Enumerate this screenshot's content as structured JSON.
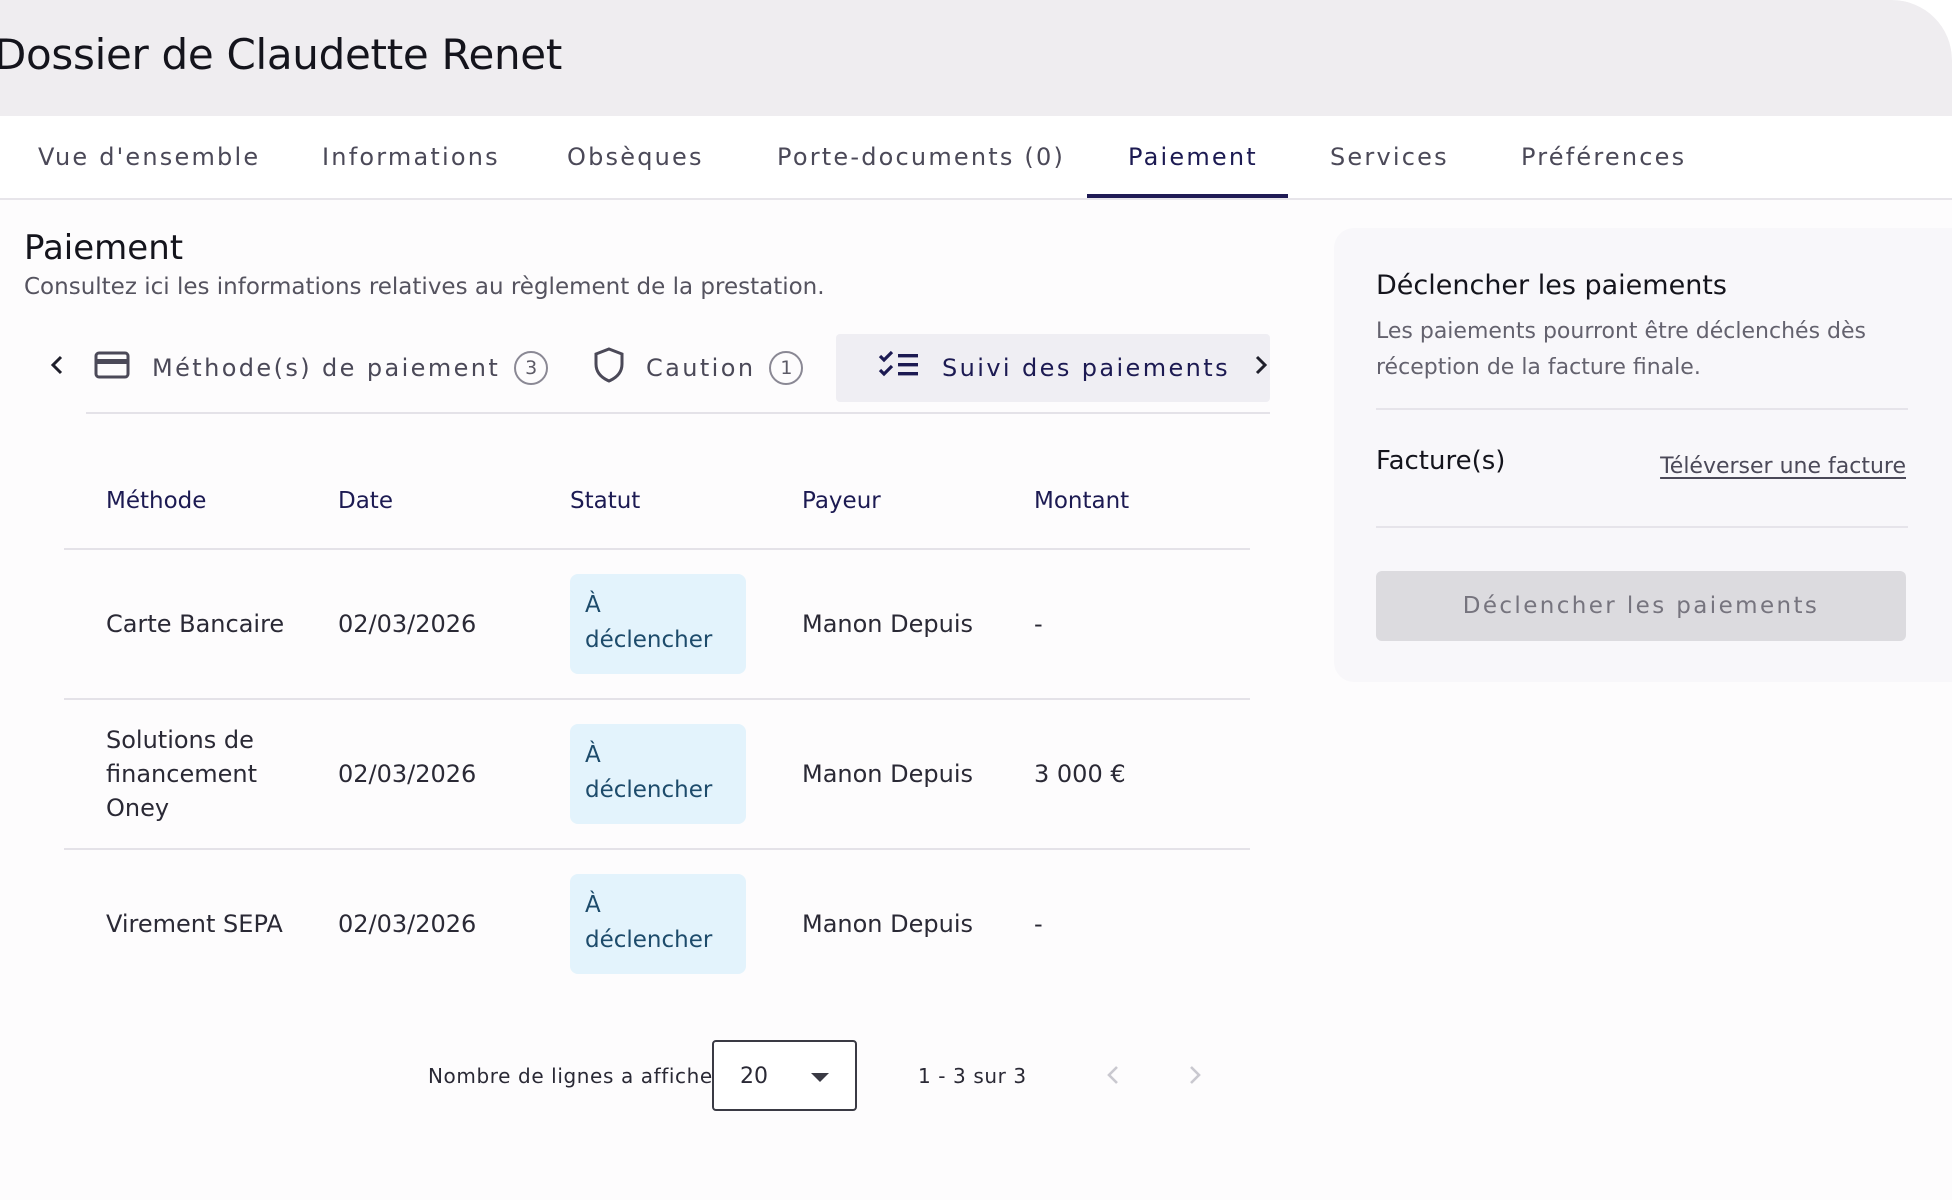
{
  "header": {
    "title": "Dossier de Claudette Renet"
  },
  "tabs": [
    {
      "label": "Vue d'ensemble"
    },
    {
      "label": "Informations"
    },
    {
      "label": "Obsèques"
    },
    {
      "label": "Porte-documents (0)"
    },
    {
      "label": "Paiement",
      "active": true
    },
    {
      "label": "Services"
    },
    {
      "label": "Préférences"
    }
  ],
  "section": {
    "title": "Paiement",
    "description": "Consultez ici les informations relatives au règlement de la prestation."
  },
  "subtabs": [
    {
      "label": "Méthode(s) de paiement",
      "count": "3",
      "icon": "credit-card-icon"
    },
    {
      "label": "Caution",
      "count": "1",
      "icon": "shield-icon"
    },
    {
      "label": "Suivi des paiements",
      "icon": "checklist-icon",
      "active": true
    }
  ],
  "table": {
    "headers": [
      "Méthode",
      "Date",
      "Statut",
      "Payeur",
      "Montant"
    ],
    "rows": [
      {
        "method": "Carte Bancaire",
        "date": "02/03/2026",
        "status_line1": "À",
        "status_line2": "déclencher",
        "payer": "Manon Depuis",
        "amount": "-"
      },
      {
        "method_line1": "Solutions de",
        "method_line2": "financement",
        "method_line3": "Oney",
        "date": "02/03/2026",
        "status_line1": "À",
        "status_line2": "déclencher",
        "payer": "Manon Depuis",
        "amount": "3 000 €"
      },
      {
        "method": "Virement SEPA",
        "date": "02/03/2026",
        "status_line1": "À",
        "status_line2": "déclencher",
        "payer": "Manon Depuis",
        "amount": "-"
      }
    ]
  },
  "pagination": {
    "rows_label": "Nombre de lignes a afficher",
    "rows_value": "20",
    "range": "1 - 3 sur 3"
  },
  "side_panel": {
    "title": "Déclencher les paiements",
    "description": "Les paiements pourront être déclenchés dès réception de la facture finale.",
    "invoices_title": "Facture(s)",
    "upload_link": "Téléverser une facture",
    "trigger_button": "Déclencher les paiements"
  },
  "colors": {
    "accent": "#1f1b55",
    "badge_bg": "#e3f3fc",
    "badge_text": "#1d4b6b",
    "disabled_button": "#dcdbdf"
  }
}
